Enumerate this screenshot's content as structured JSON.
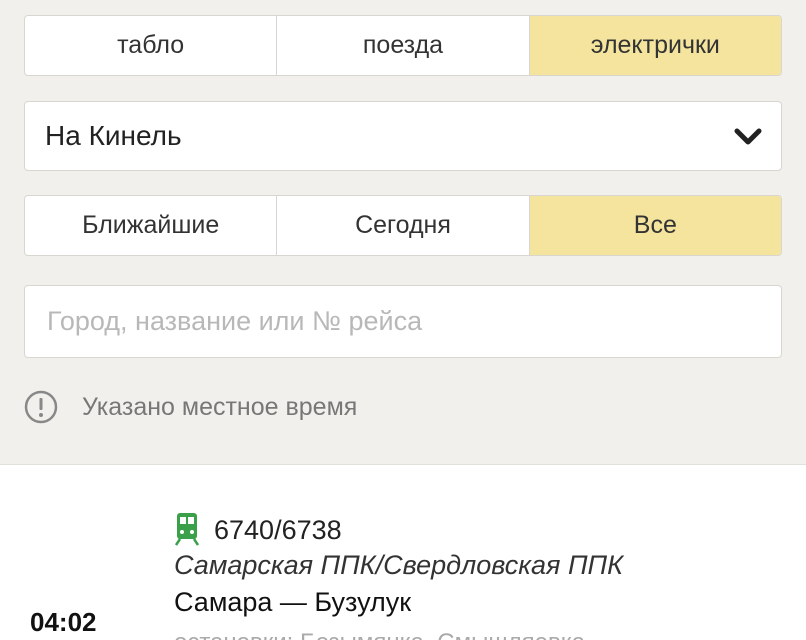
{
  "type_tabs": [
    {
      "label": "табло",
      "active": false
    },
    {
      "label": "поезда",
      "active": false
    },
    {
      "label": "электрички",
      "active": true
    }
  ],
  "direction": {
    "selected": "На Кинель",
    "icon": "chevron-down-icon"
  },
  "when_tabs": [
    {
      "label": "Ближайшие",
      "active": false
    },
    {
      "label": "Сегодня",
      "active": false
    },
    {
      "label": "Все",
      "active": true
    }
  ],
  "search": {
    "placeholder": "Город, название или № рейса",
    "value": ""
  },
  "notice": {
    "text": "Указано местное время",
    "icon": "info-icon"
  },
  "trip": {
    "time": "04:02",
    "icon": "suburban-train-icon",
    "number": "6740/6738",
    "carrier": "Самарская ППК/Свердловская ППК",
    "route": "Самара — Бузулук",
    "stops": "остановки: Безымянка, Смышляевка"
  },
  "colors": {
    "accent": "#f5e49e",
    "background": "#f1f0ec",
    "train_icon": "#3aa14a"
  }
}
